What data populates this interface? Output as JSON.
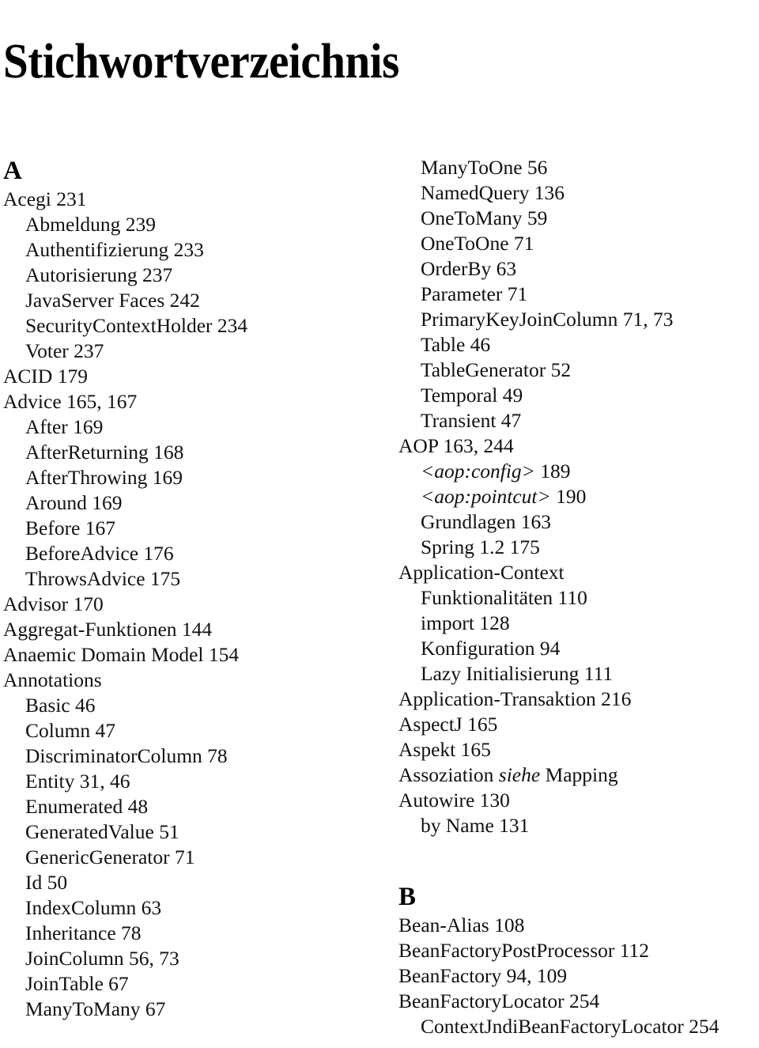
{
  "document": {
    "title": "Stichwortverzeichnis"
  },
  "columns": {
    "left": {
      "blocks": [
        {
          "type": "letter",
          "label": "A",
          "spaced_above": false
        },
        {
          "type": "entry",
          "level": 1,
          "text": "Acegi 231"
        },
        {
          "type": "entry",
          "level": 2,
          "text": "Abmeldung 239"
        },
        {
          "type": "entry",
          "level": 2,
          "text": "Authentifizierung 233"
        },
        {
          "type": "entry",
          "level": 2,
          "text": "Autorisierung 237"
        },
        {
          "type": "entry",
          "level": 2,
          "text": "JavaServer Faces 242"
        },
        {
          "type": "entry",
          "level": 2,
          "text": "SecurityContextHolder 234"
        },
        {
          "type": "entry",
          "level": 2,
          "text": "Voter 237"
        },
        {
          "type": "entry",
          "level": 1,
          "text": "ACID 179"
        },
        {
          "type": "entry",
          "level": 1,
          "text": "Advice 165, 167"
        },
        {
          "type": "entry",
          "level": 2,
          "text": "After 169"
        },
        {
          "type": "entry",
          "level": 2,
          "text": "AfterReturning 168"
        },
        {
          "type": "entry",
          "level": 2,
          "text": "AfterThrowing 169"
        },
        {
          "type": "entry",
          "level": 2,
          "text": "Around 169"
        },
        {
          "type": "entry",
          "level": 2,
          "text": "Before 167"
        },
        {
          "type": "entry",
          "level": 2,
          "text": "BeforeAdvice 176"
        },
        {
          "type": "entry",
          "level": 2,
          "text": "ThrowsAdvice 175"
        },
        {
          "type": "entry",
          "level": 1,
          "text": "Advisor 170"
        },
        {
          "type": "entry",
          "level": 1,
          "text": "Aggregat-Funktionen 144"
        },
        {
          "type": "entry",
          "level": 1,
          "text": "Anaemic Domain Model 154"
        },
        {
          "type": "entry",
          "level": 1,
          "text": "Annotations"
        },
        {
          "type": "entry",
          "level": 2,
          "text": "Basic 46"
        },
        {
          "type": "entry",
          "level": 2,
          "text": "Column 47"
        },
        {
          "type": "entry",
          "level": 2,
          "text": "DiscriminatorColumn 78"
        },
        {
          "type": "entry",
          "level": 2,
          "text": "Entity 31, 46"
        },
        {
          "type": "entry",
          "level": 2,
          "text": "Enumerated 48"
        },
        {
          "type": "entry",
          "level": 2,
          "text": "GeneratedValue 51"
        },
        {
          "type": "entry",
          "level": 2,
          "text": "GenericGenerator 71"
        },
        {
          "type": "entry",
          "level": 2,
          "text": "Id 50"
        },
        {
          "type": "entry",
          "level": 2,
          "text": "IndexColumn 63"
        },
        {
          "type": "entry",
          "level": 2,
          "text": "Inheritance 78"
        },
        {
          "type": "entry",
          "level": 2,
          "text": "JoinColumn 56, 73"
        },
        {
          "type": "entry",
          "level": 2,
          "text": "JoinTable 67"
        },
        {
          "type": "entry",
          "level": 2,
          "text": "ManyToMany 67"
        }
      ]
    },
    "right": {
      "blocks": [
        {
          "type": "entry",
          "level": 2,
          "text": "ManyToOne 56"
        },
        {
          "type": "entry",
          "level": 2,
          "text": "NamedQuery 136"
        },
        {
          "type": "entry",
          "level": 2,
          "text": "OneToMany 59"
        },
        {
          "type": "entry",
          "level": 2,
          "text": "OneToOne 71"
        },
        {
          "type": "entry",
          "level": 2,
          "text": "OrderBy 63"
        },
        {
          "type": "entry",
          "level": 2,
          "text": "Parameter 71"
        },
        {
          "type": "entry",
          "level": 2,
          "text": "PrimaryKeyJoinColumn 71, 73"
        },
        {
          "type": "entry",
          "level": 2,
          "text": "Table 46"
        },
        {
          "type": "entry",
          "level": 2,
          "text": "TableGenerator 52"
        },
        {
          "type": "entry",
          "level": 2,
          "text": "Temporal 49"
        },
        {
          "type": "entry",
          "level": 2,
          "text": "Transient 47"
        },
        {
          "type": "entry",
          "level": 1,
          "text": "AOP 163, 244"
        },
        {
          "type": "entry",
          "level": 2,
          "italic_prefix": "<aop:config>",
          "text": " 189"
        },
        {
          "type": "entry",
          "level": 2,
          "italic_prefix": "<aop:pointcut>",
          "text": " 190"
        },
        {
          "type": "entry",
          "level": 2,
          "text": "Grundlagen 163"
        },
        {
          "type": "entry",
          "level": 2,
          "text": "Spring 1.2 175"
        },
        {
          "type": "entry",
          "level": 1,
          "text": "Application-Context"
        },
        {
          "type": "entry",
          "level": 2,
          "text": "Funktionalitäten 110"
        },
        {
          "type": "entry",
          "level": 2,
          "text": "import 128"
        },
        {
          "type": "entry",
          "level": 2,
          "text": "Konfiguration 94"
        },
        {
          "type": "entry",
          "level": 2,
          "text": "Lazy Initialisierung 111"
        },
        {
          "type": "entry",
          "level": 1,
          "text": "Application-Transaktion 216"
        },
        {
          "type": "entry",
          "level": 1,
          "text": "AspectJ 165"
        },
        {
          "type": "entry",
          "level": 1,
          "text": "Aspekt 165"
        },
        {
          "type": "entry",
          "level": 1,
          "text": "Assoziation ",
          "italic_mid": "siehe",
          "text_after": " Mapping"
        },
        {
          "type": "entry",
          "level": 1,
          "text": "Autowire 130"
        },
        {
          "type": "entry",
          "level": 2,
          "text": "by Name 131"
        },
        {
          "type": "letter",
          "label": "B",
          "spaced_above": true
        },
        {
          "type": "entry",
          "level": 1,
          "text": "Bean-Alias 108"
        },
        {
          "type": "entry",
          "level": 1,
          "text": "BeanFactoryPostProcessor 112"
        },
        {
          "type": "entry",
          "level": 1,
          "text": "BeanFactory 94, 109"
        },
        {
          "type": "entry",
          "level": 1,
          "text": "BeanFactoryLocator 254"
        },
        {
          "type": "entry",
          "level": 2,
          "text": "ContextJndiBeanFactoryLocator 254"
        }
      ]
    }
  }
}
